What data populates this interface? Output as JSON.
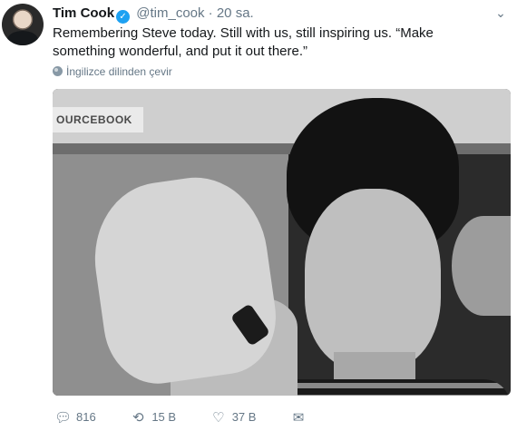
{
  "tweet": {
    "author_name": "Tim Cook",
    "verified_glyph": "✓",
    "handle": "@tim_cook",
    "separator": "·",
    "time": "20 sa.",
    "text": "Remembering Steve today. Still with us, still inspiring us. “Make something wonderful, and put it out there.”",
    "translate_label": "İngilizce dilinden çevir",
    "menu_icon": "chevron-down-icon",
    "accent_color": "#1da1f2",
    "secondary_color": "#657786"
  },
  "actions": {
    "reply_count": "816",
    "retweet_count": "15 B",
    "like_count": "37 B"
  },
  "photo": {
    "visible_text": "OURCEBOOK"
  }
}
